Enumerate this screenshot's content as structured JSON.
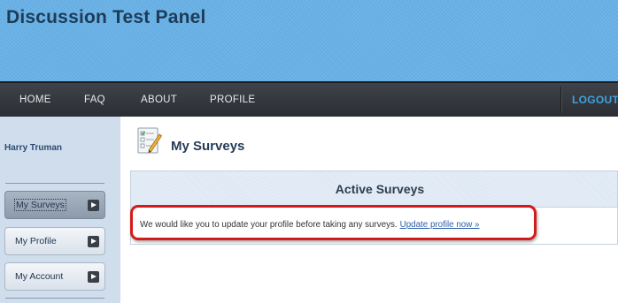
{
  "header": {
    "title": "Discussion Test Panel"
  },
  "nav": {
    "items": [
      {
        "label": "HOME"
      },
      {
        "label": "FAQ"
      },
      {
        "label": "ABOUT"
      },
      {
        "label": "PROFILE"
      }
    ],
    "logout": "LOGOUT"
  },
  "sidebar": {
    "user_name": "Harry Truman",
    "items": [
      {
        "label": "My Surveys",
        "active": true
      },
      {
        "label": "My Profile",
        "active": false
      },
      {
        "label": "My Account",
        "active": false
      }
    ]
  },
  "main": {
    "title": "My Surveys",
    "active_surveys": {
      "heading": "Active Surveys",
      "message": "We would like you to update your profile before taking any surveys.",
      "link": "Update profile now »"
    }
  },
  "colors": {
    "header_bg": "#63ade3",
    "nav_bg": "#2b2e33",
    "logout": "#3fa2dd",
    "callout_border": "#d41a1a"
  }
}
